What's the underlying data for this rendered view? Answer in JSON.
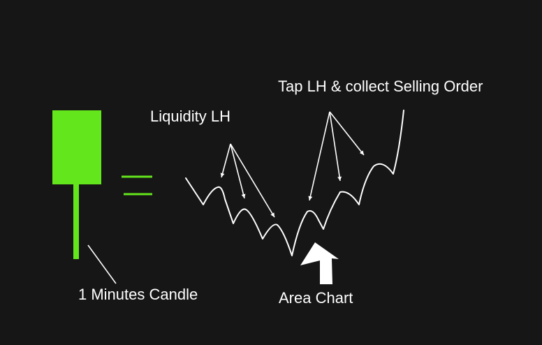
{
  "labels": {
    "tap_lh": "Tap LH & collect Selling Order",
    "liquidity_lh": "Liquidity LH",
    "candle": "1 Minutes Candle",
    "area_chart": "Area Chart"
  },
  "colors": {
    "background": "#161616",
    "candle": "#64e61c",
    "line": "#ffffff"
  }
}
